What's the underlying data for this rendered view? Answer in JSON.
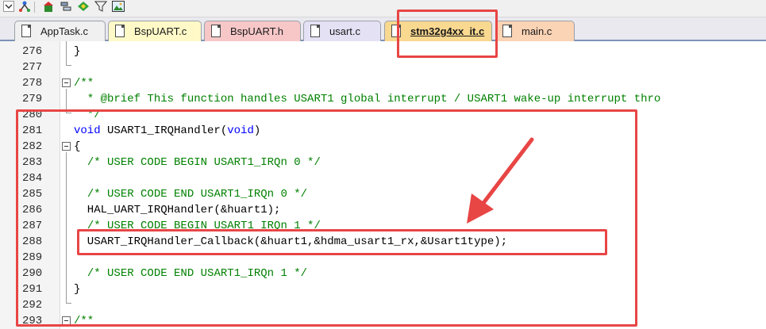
{
  "toolbar": {
    "icons": [
      "dropdown-arrow-icon",
      "hierarchy-icon",
      "building-icon",
      "layers-icon",
      "diamond-icon",
      "funnel-icon",
      "image-icon"
    ]
  },
  "tabs": [
    {
      "label": "AppTask.c",
      "color": "#f0f0f0"
    },
    {
      "label": "BspUART.c",
      "color": "#fff9c8"
    },
    {
      "label": "BspUART.h",
      "color": "#f7c7c8"
    },
    {
      "label": "usart.c",
      "color": "#e5e1f5"
    },
    {
      "label": "stm32g4xx_it.c",
      "color": "#f9d890",
      "active": true
    },
    {
      "label": "main.c",
      "color": "#fbd3b5"
    }
  ],
  "editor": {
    "lines": [
      {
        "num": "276",
        "segs": [
          {
            "t": "}",
            "c": ""
          }
        ]
      },
      {
        "num": "277",
        "segs": []
      },
      {
        "num": "278",
        "segs": [
          {
            "t": "/**",
            "c": "cm"
          }
        ]
      },
      {
        "num": "279",
        "segs": [
          {
            "t": "  * @brief This function handles USART1 global interrupt / USART1 wake-up interrupt thro",
            "c": "cm"
          }
        ]
      },
      {
        "num": "280",
        "segs": [
          {
            "t": "  */",
            "c": "cm"
          }
        ]
      },
      {
        "num": "281",
        "segs": [
          {
            "t": "void",
            "c": "kw"
          },
          {
            "t": " USART1_IRQHandler(",
            "c": ""
          },
          {
            "t": "void",
            "c": "kw"
          },
          {
            "t": ")",
            "c": ""
          }
        ]
      },
      {
        "num": "282",
        "segs": [
          {
            "t": "{",
            "c": ""
          }
        ]
      },
      {
        "num": "283",
        "segs": [
          {
            "t": "  ",
            "c": ""
          },
          {
            "t": "/* USER CODE BEGIN USART1_IRQn 0 */",
            "c": "cm"
          }
        ]
      },
      {
        "num": "284",
        "segs": []
      },
      {
        "num": "285",
        "segs": [
          {
            "t": "  ",
            "c": ""
          },
          {
            "t": "/* USER CODE END USART1_IRQn 0 */",
            "c": "cm"
          }
        ]
      },
      {
        "num": "286",
        "segs": [
          {
            "t": "  HAL_UART_IRQHandler(&huart1);",
            "c": ""
          }
        ]
      },
      {
        "num": "287",
        "segs": [
          {
            "t": "  ",
            "c": ""
          },
          {
            "t": "/* USER CODE BEGIN USART1_IRQn 1 */",
            "c": "cm"
          }
        ]
      },
      {
        "num": "288",
        "segs": [
          {
            "t": "  USART_IRQHandler_Callback(&huart1,&hdma_usart1_rx,&Usart1type);",
            "c": ""
          }
        ]
      },
      {
        "num": "289",
        "segs": []
      },
      {
        "num": "290",
        "segs": [
          {
            "t": "  ",
            "c": ""
          },
          {
            "t": "/* USER CODE END USART1_IRQn 1 */",
            "c": "cm"
          }
        ]
      },
      {
        "num": "291",
        "segs": [
          {
            "t": "}",
            "c": ""
          }
        ]
      },
      {
        "num": "292",
        "segs": []
      },
      {
        "num": "293",
        "segs": [
          {
            "t": "/**",
            "c": "cm"
          }
        ]
      }
    ]
  },
  "annotation_color": "#e84545"
}
